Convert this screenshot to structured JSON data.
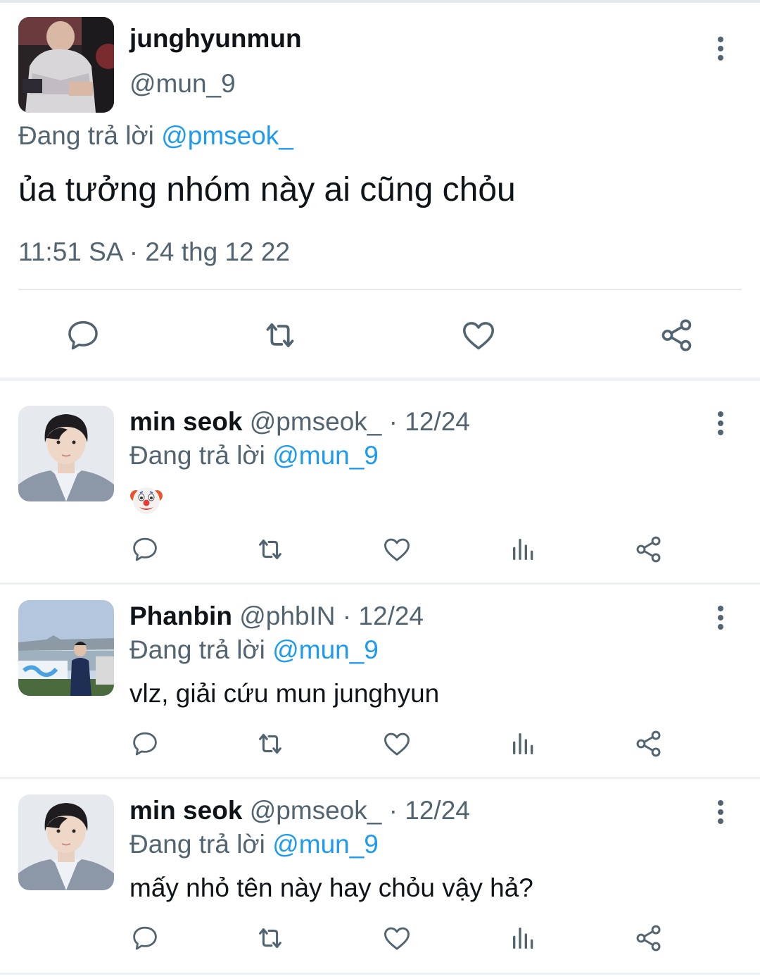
{
  "main_tweet": {
    "display_name": "junghyunmun",
    "handle": "@mun_9",
    "replying_prefix": "Đang trả lời",
    "replying_to": "@pmseok_",
    "text": "ủa tưởng nhóm này ai cũng chỏu",
    "timestamp": "11:51 SA · 24 thg 12 22",
    "actions": [
      "reply-icon",
      "retweet-icon",
      "like-icon",
      "share-icon"
    ]
  },
  "replies": [
    {
      "display_name": "min seok",
      "handle": "@pmseok_ · 12/24",
      "replying_prefix": "Đang trả lời",
      "replying_to": "@mun_9",
      "text": "",
      "emoji": "clown-face",
      "actions": [
        "reply-icon",
        "retweet-icon",
        "like-icon",
        "views-icon",
        "share-icon"
      ]
    },
    {
      "display_name": "Phanbin",
      "handle": "@phbIN · 12/24",
      "replying_prefix": "Đang trả lời",
      "replying_to": "@mun_9",
      "text": "vlz, giải cứu mun junghyun",
      "actions": [
        "reply-icon",
        "retweet-icon",
        "like-icon",
        "views-icon",
        "share-icon"
      ]
    },
    {
      "display_name": "min seok",
      "handle": "@pmseok_ · 12/24",
      "replying_prefix": "Đang trả lời",
      "replying_to": "@mun_9",
      "text": "mấy nhỏ tên này hay chỏu vậy hả?",
      "actions": [
        "reply-icon",
        "retweet-icon",
        "like-icon",
        "views-icon",
        "share-icon"
      ]
    }
  ],
  "colors": {
    "text": "#0f1419",
    "secondary": "#536471",
    "link": "#1d9bf0",
    "divider": "#eef1f3"
  }
}
